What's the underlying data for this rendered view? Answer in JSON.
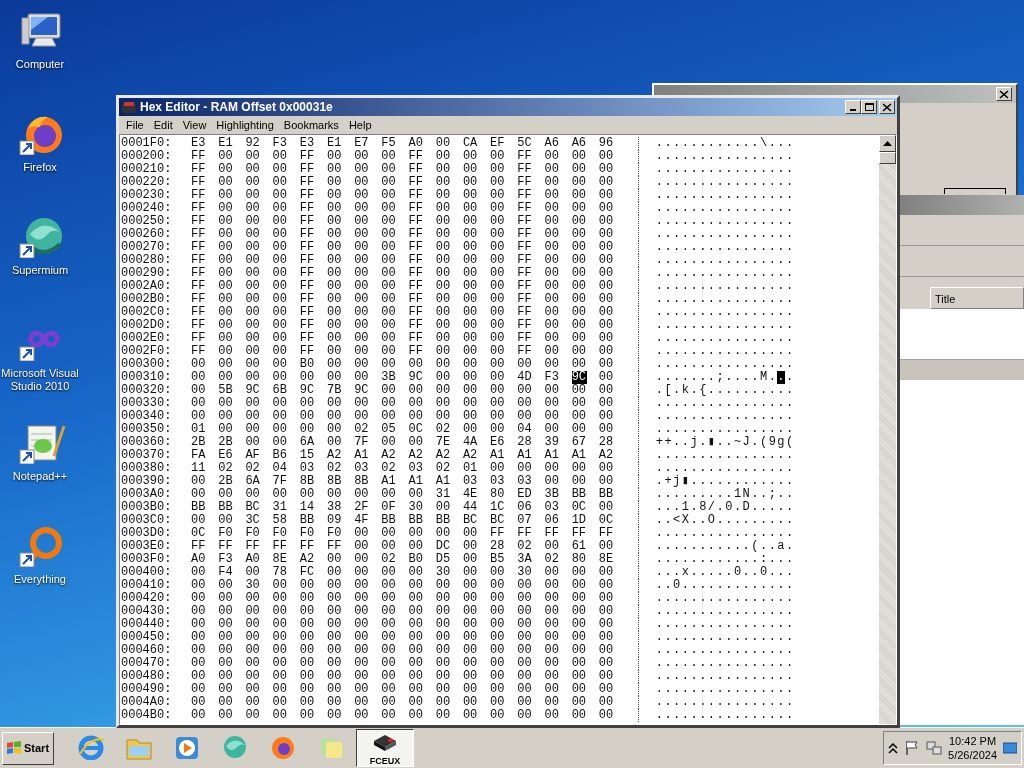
{
  "desktop_icons": [
    {
      "label": "Computer",
      "kind": "computer"
    },
    {
      "label": "Firefox",
      "kind": "firefox"
    },
    {
      "label": "Supermium",
      "kind": "supermium"
    },
    {
      "label": "Microsoft Visual Studio 2010",
      "kind": "vstudio"
    },
    {
      "label": "Notepad++",
      "kind": "notepad"
    },
    {
      "label": "Everything",
      "kind": "everything"
    }
  ],
  "list_window": {
    "columns": [
      "Title"
    ]
  },
  "hex_editor": {
    "title": "Hex Editor - RAM Offset 0x00031e",
    "menu": [
      "File",
      "Edit",
      "View",
      "Highlighting",
      "Bookmarks",
      "Help"
    ],
    "rows": [
      {
        "offset": "0001F0:",
        "hex": [
          "E3",
          "E1",
          "92",
          "F3",
          "E3",
          "E1",
          "E7",
          "F5",
          "A0",
          "00",
          "CA",
          "EF",
          "5C",
          "A6",
          "A6",
          "96"
        ],
        "ascii": "............\\...",
        "selected": [
          false,
          false,
          false,
          false,
          false,
          false,
          false,
          false,
          false,
          false,
          false,
          false,
          false,
          false,
          false,
          false
        ]
      },
      {
        "offset": "000200:",
        "hex": [
          "FF",
          "00",
          "00",
          "00",
          "FF",
          "00",
          "00",
          "00",
          "FF",
          "00",
          "00",
          "00",
          "FF",
          "00",
          "00",
          "00"
        ],
        "ascii": "................",
        "selected": [
          false,
          false,
          false,
          false,
          false,
          false,
          false,
          false,
          false,
          false,
          false,
          false,
          false,
          false,
          false,
          false
        ]
      },
      {
        "offset": "000210:",
        "hex": [
          "FF",
          "00",
          "00",
          "00",
          "FF",
          "00",
          "00",
          "00",
          "FF",
          "00",
          "00",
          "00",
          "FF",
          "00",
          "00",
          "00"
        ],
        "ascii": "................",
        "selected": [
          false,
          false,
          false,
          false,
          false,
          false,
          false,
          false,
          false,
          false,
          false,
          false,
          false,
          false,
          false,
          false
        ]
      },
      {
        "offset": "000220:",
        "hex": [
          "FF",
          "00",
          "00",
          "00",
          "FF",
          "00",
          "00",
          "00",
          "FF",
          "00",
          "00",
          "00",
          "FF",
          "00",
          "00",
          "00"
        ],
        "ascii": "................",
        "selected": [
          false,
          false,
          false,
          false,
          false,
          false,
          false,
          false,
          false,
          false,
          false,
          false,
          false,
          false,
          false,
          false
        ]
      },
      {
        "offset": "000230:",
        "hex": [
          "FF",
          "00",
          "00",
          "00",
          "FF",
          "00",
          "00",
          "00",
          "FF",
          "00",
          "00",
          "00",
          "FF",
          "00",
          "00",
          "00"
        ],
        "ascii": "................",
        "selected": [
          false,
          false,
          false,
          false,
          false,
          false,
          false,
          false,
          false,
          false,
          false,
          false,
          false,
          false,
          false,
          false
        ]
      },
      {
        "offset": "000240:",
        "hex": [
          "FF",
          "00",
          "00",
          "00",
          "FF",
          "00",
          "00",
          "00",
          "FF",
          "00",
          "00",
          "00",
          "FF",
          "00",
          "00",
          "00"
        ],
        "ascii": "................",
        "selected": [
          false,
          false,
          false,
          false,
          false,
          false,
          false,
          false,
          false,
          false,
          false,
          false,
          false,
          false,
          false,
          false
        ]
      },
      {
        "offset": "000250:",
        "hex": [
          "FF",
          "00",
          "00",
          "00",
          "FF",
          "00",
          "00",
          "00",
          "FF",
          "00",
          "00",
          "00",
          "FF",
          "00",
          "00",
          "00"
        ],
        "ascii": "................",
        "selected": [
          false,
          false,
          false,
          false,
          false,
          false,
          false,
          false,
          false,
          false,
          false,
          false,
          false,
          false,
          false,
          false
        ]
      },
      {
        "offset": "000260:",
        "hex": [
          "FF",
          "00",
          "00",
          "00",
          "FF",
          "00",
          "00",
          "00",
          "FF",
          "00",
          "00",
          "00",
          "FF",
          "00",
          "00",
          "00"
        ],
        "ascii": "................",
        "selected": [
          false,
          false,
          false,
          false,
          false,
          false,
          false,
          false,
          false,
          false,
          false,
          false,
          false,
          false,
          false,
          false
        ]
      },
      {
        "offset": "000270:",
        "hex": [
          "FF",
          "00",
          "00",
          "00",
          "FF",
          "00",
          "00",
          "00",
          "FF",
          "00",
          "00",
          "00",
          "FF",
          "00",
          "00",
          "00"
        ],
        "ascii": "................",
        "selected": [
          false,
          false,
          false,
          false,
          false,
          false,
          false,
          false,
          false,
          false,
          false,
          false,
          false,
          false,
          false,
          false
        ]
      },
      {
        "offset": "000280:",
        "hex": [
          "FF",
          "00",
          "00",
          "00",
          "FF",
          "00",
          "00",
          "00",
          "FF",
          "00",
          "00",
          "00",
          "FF",
          "00",
          "00",
          "00"
        ],
        "ascii": "................",
        "selected": [
          false,
          false,
          false,
          false,
          false,
          false,
          false,
          false,
          false,
          false,
          false,
          false,
          false,
          false,
          false,
          false
        ]
      },
      {
        "offset": "000290:",
        "hex": [
          "FF",
          "00",
          "00",
          "00",
          "FF",
          "00",
          "00",
          "00",
          "FF",
          "00",
          "00",
          "00",
          "FF",
          "00",
          "00",
          "00"
        ],
        "ascii": "................",
        "selected": [
          false,
          false,
          false,
          false,
          false,
          false,
          false,
          false,
          false,
          false,
          false,
          false,
          false,
          false,
          false,
          false
        ]
      },
      {
        "offset": "0002A0:",
        "hex": [
          "FF",
          "00",
          "00",
          "00",
          "FF",
          "00",
          "00",
          "00",
          "FF",
          "00",
          "00",
          "00",
          "FF",
          "00",
          "00",
          "00"
        ],
        "ascii": "................",
        "selected": [
          false,
          false,
          false,
          false,
          false,
          false,
          false,
          false,
          false,
          false,
          false,
          false,
          false,
          false,
          false,
          false
        ]
      },
      {
        "offset": "0002B0:",
        "hex": [
          "FF",
          "00",
          "00",
          "00",
          "FF",
          "00",
          "00",
          "00",
          "FF",
          "00",
          "00",
          "00",
          "FF",
          "00",
          "00",
          "00"
        ],
        "ascii": "................",
        "selected": [
          false,
          false,
          false,
          false,
          false,
          false,
          false,
          false,
          false,
          false,
          false,
          false,
          false,
          false,
          false,
          false
        ]
      },
      {
        "offset": "0002C0:",
        "hex": [
          "FF",
          "00",
          "00",
          "00",
          "FF",
          "00",
          "00",
          "00",
          "FF",
          "00",
          "00",
          "00",
          "FF",
          "00",
          "00",
          "00"
        ],
        "ascii": "................",
        "selected": [
          false,
          false,
          false,
          false,
          false,
          false,
          false,
          false,
          false,
          false,
          false,
          false,
          false,
          false,
          false,
          false
        ]
      },
      {
        "offset": "0002D0:",
        "hex": [
          "FF",
          "00",
          "00",
          "00",
          "FF",
          "00",
          "00",
          "00",
          "FF",
          "00",
          "00",
          "00",
          "FF",
          "00",
          "00",
          "00"
        ],
        "ascii": "................",
        "selected": [
          false,
          false,
          false,
          false,
          false,
          false,
          false,
          false,
          false,
          false,
          false,
          false,
          false,
          false,
          false,
          false
        ]
      },
      {
        "offset": "0002E0:",
        "hex": [
          "FF",
          "00",
          "00",
          "00",
          "FF",
          "00",
          "00",
          "00",
          "FF",
          "00",
          "00",
          "00",
          "FF",
          "00",
          "00",
          "00"
        ],
        "ascii": "................",
        "selected": [
          false,
          false,
          false,
          false,
          false,
          false,
          false,
          false,
          false,
          false,
          false,
          false,
          false,
          false,
          false,
          false
        ]
      },
      {
        "offset": "0002F0:",
        "hex": [
          "FF",
          "00",
          "00",
          "00",
          "FF",
          "00",
          "00",
          "00",
          "FF",
          "00",
          "00",
          "00",
          "FF",
          "00",
          "00",
          "00"
        ],
        "ascii": "................",
        "selected": [
          false,
          false,
          false,
          false,
          false,
          false,
          false,
          false,
          false,
          false,
          false,
          false,
          false,
          false,
          false,
          false
        ]
      },
      {
        "offset": "000300:",
        "hex": [
          "00",
          "00",
          "00",
          "00",
          "B0",
          "00",
          "00",
          "00",
          "00",
          "00",
          "00",
          "00",
          "00",
          "00",
          "00",
          "00"
        ],
        "ascii": "................",
        "selected": [
          false,
          false,
          false,
          false,
          false,
          false,
          false,
          false,
          false,
          false,
          false,
          false,
          false,
          false,
          false,
          false
        ]
      },
      {
        "offset": "000310:",
        "hex": [
          "00",
          "00",
          "00",
          "00",
          "00",
          "00",
          "00",
          "3B",
          "9C",
          "00",
          "00",
          "00",
          "4D",
          "F3",
          "9C",
          "00"
        ],
        "ascii": ".......;....M...",
        "selected": [
          false,
          false,
          false,
          false,
          false,
          false,
          false,
          false,
          false,
          false,
          false,
          false,
          false,
          false,
          true,
          false
        ]
      },
      {
        "offset": "000320:",
        "hex": [
          "00",
          "5B",
          "9C",
          "6B",
          "9C",
          "7B",
          "9C",
          "00",
          "00",
          "00",
          "00",
          "00",
          "00",
          "00",
          "00",
          "00"
        ],
        "ascii": ".[.k.{..........",
        "selected": [
          false,
          false,
          false,
          false,
          false,
          false,
          false,
          false,
          false,
          false,
          false,
          false,
          false,
          false,
          false,
          false
        ]
      },
      {
        "offset": "000330:",
        "hex": [
          "00",
          "00",
          "00",
          "00",
          "00",
          "00",
          "00",
          "00",
          "00",
          "00",
          "00",
          "00",
          "00",
          "00",
          "00",
          "00"
        ],
        "ascii": "................",
        "selected": [
          false,
          false,
          false,
          false,
          false,
          false,
          false,
          false,
          false,
          false,
          false,
          false,
          false,
          false,
          false,
          false
        ]
      },
      {
        "offset": "000340:",
        "hex": [
          "00",
          "00",
          "00",
          "00",
          "00",
          "00",
          "00",
          "00",
          "00",
          "00",
          "00",
          "00",
          "00",
          "00",
          "00",
          "00"
        ],
        "ascii": "................",
        "selected": [
          false,
          false,
          false,
          false,
          false,
          false,
          false,
          false,
          false,
          false,
          false,
          false,
          false,
          false,
          false,
          false
        ]
      },
      {
        "offset": "000350:",
        "hex": [
          "01",
          "00",
          "00",
          "00",
          "00",
          "00",
          "02",
          "05",
          "0C",
          "02",
          "00",
          "00",
          "04",
          "00",
          "00",
          "00"
        ],
        "ascii": "................",
        "selected": [
          false,
          false,
          false,
          false,
          false,
          false,
          false,
          false,
          false,
          false,
          false,
          false,
          false,
          false,
          false,
          false
        ]
      },
      {
        "offset": "000360:",
        "hex": [
          "2B",
          "2B",
          "00",
          "00",
          "6A",
          "00",
          "7F",
          "00",
          "00",
          "7E",
          "4A",
          "E6",
          "28",
          "39",
          "67",
          "28"
        ],
        "ascii": "++..j.▮..~J.(9g(",
        "selected": [
          false,
          false,
          false,
          false,
          false,
          false,
          false,
          false,
          false,
          false,
          false,
          false,
          false,
          false,
          false,
          false
        ]
      },
      {
        "offset": "000370:",
        "hex": [
          "FA",
          "E6",
          "AF",
          "B6",
          "15",
          "A2",
          "A1",
          "A2",
          "A2",
          "A2",
          "A2",
          "A1",
          "A1",
          "A1",
          "A1",
          "A2"
        ],
        "ascii": "................",
        "selected": [
          false,
          false,
          false,
          false,
          false,
          false,
          false,
          false,
          false,
          false,
          false,
          false,
          false,
          false,
          false,
          false
        ]
      },
      {
        "offset": "000380:",
        "hex": [
          "11",
          "02",
          "02",
          "04",
          "03",
          "02",
          "03",
          "02",
          "03",
          "02",
          "01",
          "00",
          "00",
          "00",
          "00",
          "00"
        ],
        "ascii": "................",
        "selected": [
          false,
          false,
          false,
          false,
          false,
          false,
          false,
          false,
          false,
          false,
          false,
          false,
          false,
          false,
          false,
          false
        ]
      },
      {
        "offset": "000390:",
        "hex": [
          "00",
          "2B",
          "6A",
          "7F",
          "8B",
          "8B",
          "8B",
          "A1",
          "A1",
          "A1",
          "03",
          "03",
          "03",
          "00",
          "00",
          "00"
        ],
        "ascii": ".+j▮............",
        "selected": [
          false,
          false,
          false,
          false,
          false,
          false,
          false,
          false,
          false,
          false,
          false,
          false,
          false,
          false,
          false,
          false
        ]
      },
      {
        "offset": "0003A0:",
        "hex": [
          "00",
          "00",
          "00",
          "00",
          "00",
          "00",
          "00",
          "00",
          "00",
          "31",
          "4E",
          "80",
          "ED",
          "3B",
          "BB",
          "BB"
        ],
        "ascii": ".........1N..;..",
        "selected": [
          false,
          false,
          false,
          false,
          false,
          false,
          false,
          false,
          false,
          false,
          false,
          false,
          false,
          false,
          false,
          false
        ]
      },
      {
        "offset": "0003B0:",
        "hex": [
          "BB",
          "BB",
          "BC",
          "31",
          "14",
          "38",
          "2F",
          "0F",
          "30",
          "00",
          "44",
          "1C",
          "06",
          "03",
          "0C",
          "00"
        ],
        "ascii": "...1.8/.0.D.....",
        "selected": [
          false,
          false,
          false,
          false,
          false,
          false,
          false,
          false,
          false,
          false,
          false,
          false,
          false,
          false,
          false,
          false
        ]
      },
      {
        "offset": "0003C0:",
        "hex": [
          "00",
          "00",
          "3C",
          "58",
          "BB",
          "09",
          "4F",
          "BB",
          "BB",
          "BB",
          "BC",
          "BC",
          "07",
          "06",
          "1D",
          "0C"
        ],
        "ascii": "..<X..O.........",
        "selected": [
          false,
          false,
          false,
          false,
          false,
          false,
          false,
          false,
          false,
          false,
          false,
          false,
          false,
          false,
          false,
          false
        ]
      },
      {
        "offset": "0003D0:",
        "hex": [
          "0C",
          "F0",
          "F0",
          "F0",
          "F0",
          "F0",
          "00",
          "00",
          "00",
          "00",
          "00",
          "FF",
          "FF",
          "FF",
          "FF",
          "FF"
        ],
        "ascii": "................",
        "selected": [
          false,
          false,
          false,
          false,
          false,
          false,
          false,
          false,
          false,
          false,
          false,
          false,
          false,
          false,
          false,
          false
        ]
      },
      {
        "offset": "0003E0:",
        "hex": [
          "FF",
          "FF",
          "FF",
          "FF",
          "FF",
          "FF",
          "00",
          "00",
          "00",
          "DC",
          "00",
          "28",
          "02",
          "00",
          "61",
          "00"
        ],
        "ascii": "...........(..a.",
        "selected": [
          false,
          false,
          false,
          false,
          false,
          false,
          false,
          false,
          false,
          false,
          false,
          false,
          false,
          false,
          false,
          false
        ]
      },
      {
        "offset": "0003F0:",
        "hex": [
          "A0",
          "F3",
          "A0",
          "8E",
          "A2",
          "00",
          "00",
          "02",
          "B0",
          "D5",
          "00",
          "B5",
          "3A",
          "02",
          "80",
          "8E"
        ],
        "ascii": "............:...",
        "selected": [
          false,
          false,
          false,
          false,
          false,
          false,
          false,
          false,
          false,
          false,
          false,
          false,
          false,
          false,
          false,
          false
        ]
      },
      {
        "offset": "000400:",
        "hex": [
          "00",
          "F4",
          "00",
          "78",
          "FC",
          "00",
          "00",
          "00",
          "00",
          "30",
          "00",
          "00",
          "30",
          "00",
          "00",
          "00"
        ],
        "ascii": "...x.....0..0...",
        "selected": [
          false,
          false,
          false,
          false,
          false,
          false,
          false,
          false,
          false,
          false,
          false,
          false,
          false,
          false,
          false,
          false
        ]
      },
      {
        "offset": "000410:",
        "hex": [
          "00",
          "00",
          "30",
          "00",
          "00",
          "00",
          "00",
          "00",
          "00",
          "00",
          "00",
          "00",
          "00",
          "00",
          "00",
          "00"
        ],
        "ascii": "..0.............",
        "selected": [
          false,
          false,
          false,
          false,
          false,
          false,
          false,
          false,
          false,
          false,
          false,
          false,
          false,
          false,
          false,
          false
        ]
      },
      {
        "offset": "000420:",
        "hex": [
          "00",
          "00",
          "00",
          "00",
          "00",
          "00",
          "00",
          "00",
          "00",
          "00",
          "00",
          "00",
          "00",
          "00",
          "00",
          "00"
        ],
        "ascii": "................",
        "selected": [
          false,
          false,
          false,
          false,
          false,
          false,
          false,
          false,
          false,
          false,
          false,
          false,
          false,
          false,
          false,
          false
        ]
      },
      {
        "offset": "000430:",
        "hex": [
          "00",
          "00",
          "00",
          "00",
          "00",
          "00",
          "00",
          "00",
          "00",
          "00",
          "00",
          "00",
          "00",
          "00",
          "00",
          "00"
        ],
        "ascii": "................",
        "selected": [
          false,
          false,
          false,
          false,
          false,
          false,
          false,
          false,
          false,
          false,
          false,
          false,
          false,
          false,
          false,
          false
        ]
      },
      {
        "offset": "000440:",
        "hex": [
          "00",
          "00",
          "00",
          "00",
          "00",
          "00",
          "00",
          "00",
          "00",
          "00",
          "00",
          "00",
          "00",
          "00",
          "00",
          "00"
        ],
        "ascii": "................",
        "selected": [
          false,
          false,
          false,
          false,
          false,
          false,
          false,
          false,
          false,
          false,
          false,
          false,
          false,
          false,
          false,
          false
        ]
      },
      {
        "offset": "000450:",
        "hex": [
          "00",
          "00",
          "00",
          "00",
          "00",
          "00",
          "00",
          "00",
          "00",
          "00",
          "00",
          "00",
          "00",
          "00",
          "00",
          "00"
        ],
        "ascii": "................",
        "selected": [
          false,
          false,
          false,
          false,
          false,
          false,
          false,
          false,
          false,
          false,
          false,
          false,
          false,
          false,
          false,
          false
        ]
      },
      {
        "offset": "000460:",
        "hex": [
          "00",
          "00",
          "00",
          "00",
          "00",
          "00",
          "00",
          "00",
          "00",
          "00",
          "00",
          "00",
          "00",
          "00",
          "00",
          "00"
        ],
        "ascii": "................",
        "selected": [
          false,
          false,
          false,
          false,
          false,
          false,
          false,
          false,
          false,
          false,
          false,
          false,
          false,
          false,
          false,
          false
        ]
      },
      {
        "offset": "000470:",
        "hex": [
          "00",
          "00",
          "00",
          "00",
          "00",
          "00",
          "00",
          "00",
          "00",
          "00",
          "00",
          "00",
          "00",
          "00",
          "00",
          "00"
        ],
        "ascii": "................",
        "selected": [
          false,
          false,
          false,
          false,
          false,
          false,
          false,
          false,
          false,
          false,
          false,
          false,
          false,
          false,
          false,
          false
        ]
      },
      {
        "offset": "000480:",
        "hex": [
          "00",
          "00",
          "00",
          "00",
          "00",
          "00",
          "00",
          "00",
          "00",
          "00",
          "00",
          "00",
          "00",
          "00",
          "00",
          "00"
        ],
        "ascii": "................",
        "selected": [
          false,
          false,
          false,
          false,
          false,
          false,
          false,
          false,
          false,
          false,
          false,
          false,
          false,
          false,
          false,
          false
        ]
      },
      {
        "offset": "000490:",
        "hex": [
          "00",
          "00",
          "00",
          "00",
          "00",
          "00",
          "00",
          "00",
          "00",
          "00",
          "00",
          "00",
          "00",
          "00",
          "00",
          "00"
        ],
        "ascii": "................",
        "selected": [
          false,
          false,
          false,
          false,
          false,
          false,
          false,
          false,
          false,
          false,
          false,
          false,
          false,
          false,
          false,
          false
        ]
      },
      {
        "offset": "0004A0:",
        "hex": [
          "00",
          "00",
          "00",
          "00",
          "00",
          "00",
          "00",
          "00",
          "00",
          "00",
          "00",
          "00",
          "00",
          "00",
          "00",
          "00"
        ],
        "ascii": "................",
        "selected": [
          false,
          false,
          false,
          false,
          false,
          false,
          false,
          false,
          false,
          false,
          false,
          false,
          false,
          false,
          false,
          false
        ]
      },
      {
        "offset": "0004B0:",
        "hex": [
          "00",
          "00",
          "00",
          "00",
          "00",
          "00",
          "00",
          "00",
          "00",
          "00",
          "00",
          "00",
          "00",
          "00",
          "00",
          "00"
        ],
        "ascii": "................",
        "selected": [
          false,
          false,
          false,
          false,
          false,
          false,
          false,
          false,
          false,
          false,
          false,
          false,
          false,
          false,
          false,
          false
        ]
      }
    ]
  },
  "taskbar": {
    "start": "Start",
    "items": [
      {
        "kind": "ie",
        "active": false
      },
      {
        "kind": "explorer",
        "active": false
      },
      {
        "kind": "media",
        "active": false
      },
      {
        "kind": "supermium",
        "active": false
      },
      {
        "kind": "firefox",
        "active": false
      },
      {
        "kind": "notes",
        "active": false
      },
      {
        "kind": "fceux",
        "label": "FCEUX",
        "active": true
      }
    ],
    "clock": {
      "time": "10:42 PM",
      "date": "5/26/2024"
    }
  }
}
